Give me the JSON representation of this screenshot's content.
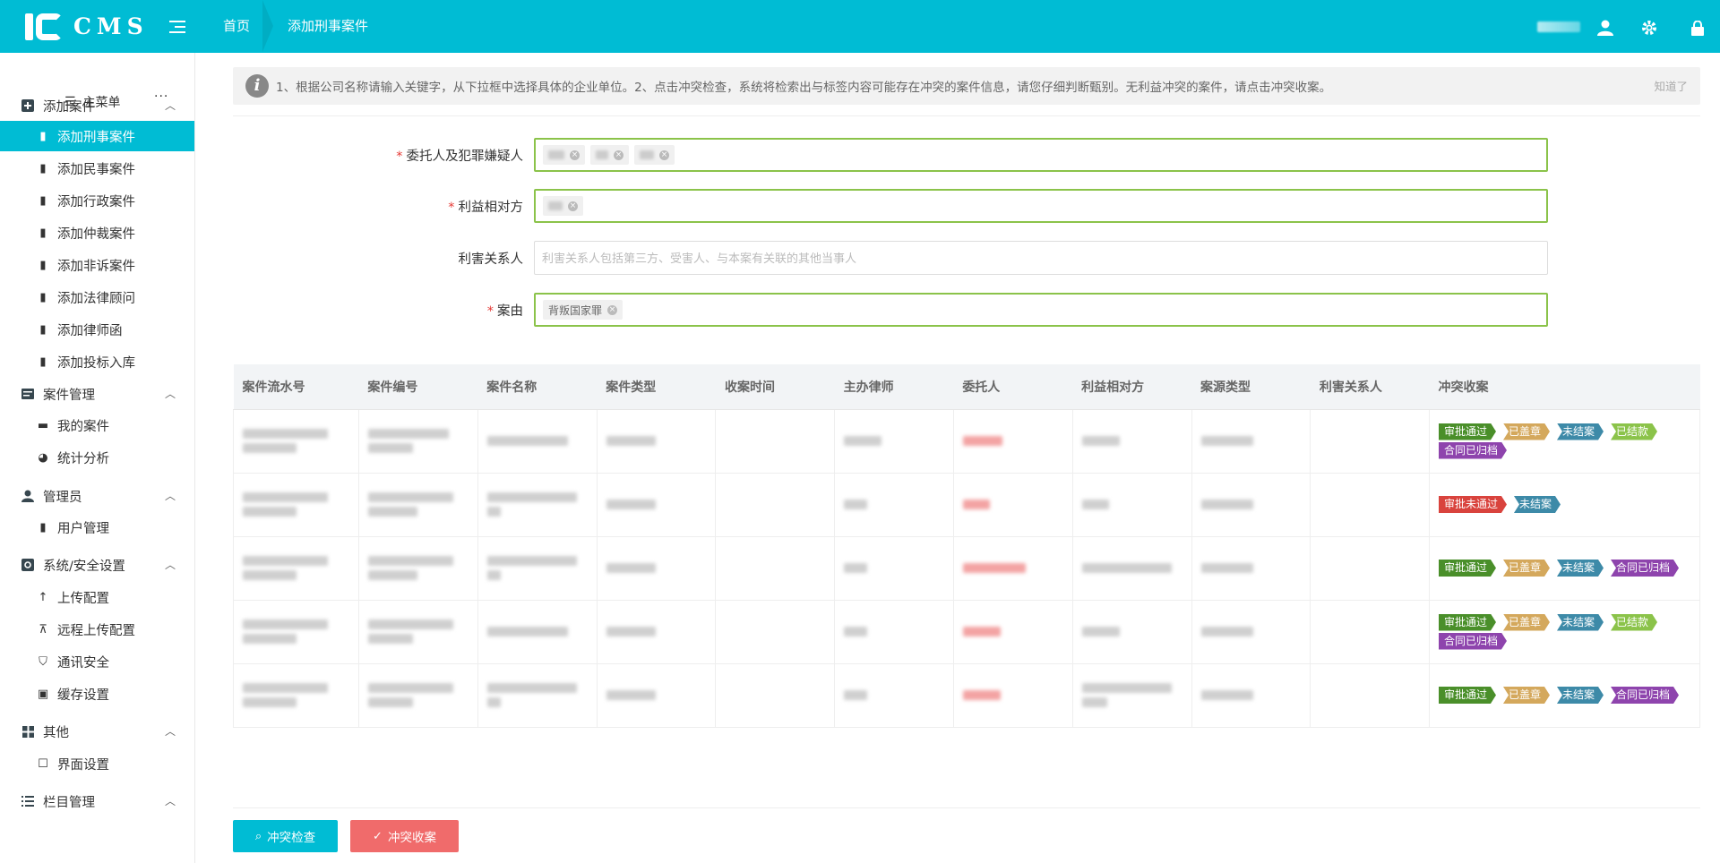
{
  "app": {
    "logo_text": "CMS",
    "breadcrumb": [
      "首页",
      "添加刑事案件"
    ]
  },
  "sidebar": {
    "main_menu": "主菜单",
    "more": "···",
    "groups": [
      {
        "label": "添加案件",
        "icon": "plus-square-icon",
        "items": [
          "添加刑事案件",
          "添加民事案件",
          "添加行政案件",
          "添加仲裁案件",
          "添加非诉案件",
          "添加法律顾问",
          "添加律师函",
          "添加投标入库"
        ]
      },
      {
        "label": "案件管理",
        "icon": "list-card-icon",
        "items": [
          "我的案件",
          "统计分析"
        ]
      },
      {
        "label": "管理员",
        "icon": "user-icon",
        "items": [
          "用户管理"
        ]
      },
      {
        "label": "系统/安全设置",
        "icon": "gear-box-icon",
        "items": [
          "上传配置",
          "远程上传配置",
          "通讯安全",
          "缓存设置"
        ]
      },
      {
        "label": "其他",
        "icon": "grid-icon",
        "items": [
          "界面设置"
        ]
      },
      {
        "label": "栏目管理",
        "icon": "list-icon",
        "items": []
      }
    ],
    "active_item": "添加刑事案件"
  },
  "tip": {
    "text": "1、根据公司名称请输入关键字，从下拉框中选择具体的企业单位。2、点击冲突检查，系统将检索出与标签内容可能存在冲突的案件信息，请您仔细判断甄别。无利益冲突的案件，请点击冲突收案。",
    "dismiss": "知道了"
  },
  "form": {
    "client_label": "委托人及犯罪嫌疑人",
    "opponent_label": "利益相对方",
    "stakeholder_label": "利害关系人",
    "stakeholder_placeholder": "利害关系人包括第三方、受害人、与本案有关联的其他当事人",
    "cause_label": "案由",
    "cause_tag": "背叛国家罪"
  },
  "table": {
    "headers": [
      "案件流水号",
      "案件编号",
      "案件名称",
      "案件类型",
      "收案时间",
      "主办律师",
      "委托人",
      "利益相对方",
      "案源类型",
      "利害关系人",
      "冲突收案"
    ],
    "rows": [
      {
        "badges": [
          "审批通过",
          "已盖章",
          "未结案",
          "已结款",
          "合同已归档"
        ]
      },
      {
        "badges": [
          "审批未通过",
          "未结案"
        ]
      },
      {
        "badges": [
          "审批通过",
          "已盖章",
          "未结案",
          "合同已归档"
        ]
      },
      {
        "badges": [
          "审批通过",
          "已盖章",
          "未结案",
          "已结款",
          "合同已归档"
        ]
      },
      {
        "badges": [
          "审批通过",
          "已盖章",
          "未结案",
          "合同已归档"
        ]
      }
    ]
  },
  "buttons": {
    "check": "冲突检查",
    "accept": "冲突收案"
  },
  "colors": {
    "primary": "#00bcd4",
    "danger": "#f06b6b",
    "valid_border": "#8bc34a"
  }
}
